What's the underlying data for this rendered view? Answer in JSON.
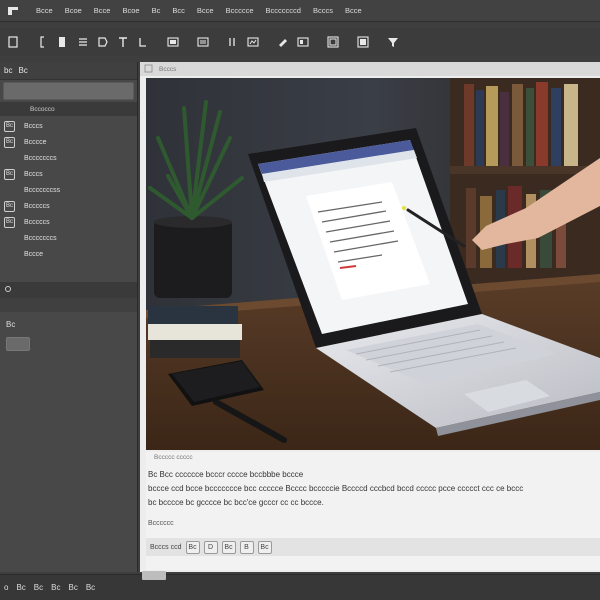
{
  "menubar": {
    "items": [
      "Bcce",
      "Bcoe",
      "Bcce",
      "Bcoe",
      "Bc",
      "Bcc",
      "Bcce",
      "Bccccce",
      "Bcccccccd",
      "Bcccs",
      "Bcce"
    ]
  },
  "toolbar": {
    "icons": [
      "new-doc-icon",
      "bracket-icon",
      "page-icon",
      "list-icon",
      "tag-icon",
      "text-icon",
      "format-icon",
      "image-icon",
      "media-icon",
      "table-icon",
      "chart-icon",
      "draw-icon",
      "frame-icon",
      "grid-icon",
      "picture-icon",
      "filter-icon"
    ]
  },
  "sidebar": {
    "header_icons": [
      "bc",
      "Bc"
    ],
    "section_label": "Bccocco",
    "items": [
      {
        "icon": "Bc",
        "label": "Bcccs"
      },
      {
        "icon": "Bc",
        "label": "Bcccce"
      },
      {
        "icon": "",
        "label": "Bcccccccs"
      },
      {
        "icon": "Bc",
        "label": "Bcccs"
      },
      {
        "icon": "",
        "label": "Bcccccccss"
      },
      {
        "icon": "Bc",
        "label": "Bcccccs"
      },
      {
        "icon": "Bc",
        "label": "Bcccccs"
      },
      {
        "icon": "",
        "label": "Bcccccccs"
      },
      {
        "icon": "",
        "label": "Bccce"
      }
    ],
    "lower_label": "Bc"
  },
  "document": {
    "tab_label": "Bcccs",
    "caption_small": "Bccccc ccccc",
    "caption_line1": "Bc  Bcc cccccce bcccr cccce bccbbbe bccce",
    "caption_line2": "bccce ccd bcce bccccccce bcc ccccce Bcccc bcccccie Bccccd cccbcd bccd ccccc pcce ccccct ccc ce bccc",
    "caption_line3": "bc bcccce bc gcccce bc bcc'ce gcccr cc cc bccce.",
    "caption_note": "Bcccccc",
    "format_label": "Bcccs ccd",
    "format_buttons": [
      "Bc",
      "D",
      "Bc",
      "B",
      "Bc"
    ]
  },
  "statusbar": {
    "items": [
      "o",
      "Bc",
      "Bc",
      "Bc",
      "Bc",
      "Bc"
    ]
  },
  "colors": {
    "chrome": "#3e3e3e",
    "sidebar": "#484848",
    "document": "#ededed",
    "screen_accent": "#4a5a9a"
  }
}
